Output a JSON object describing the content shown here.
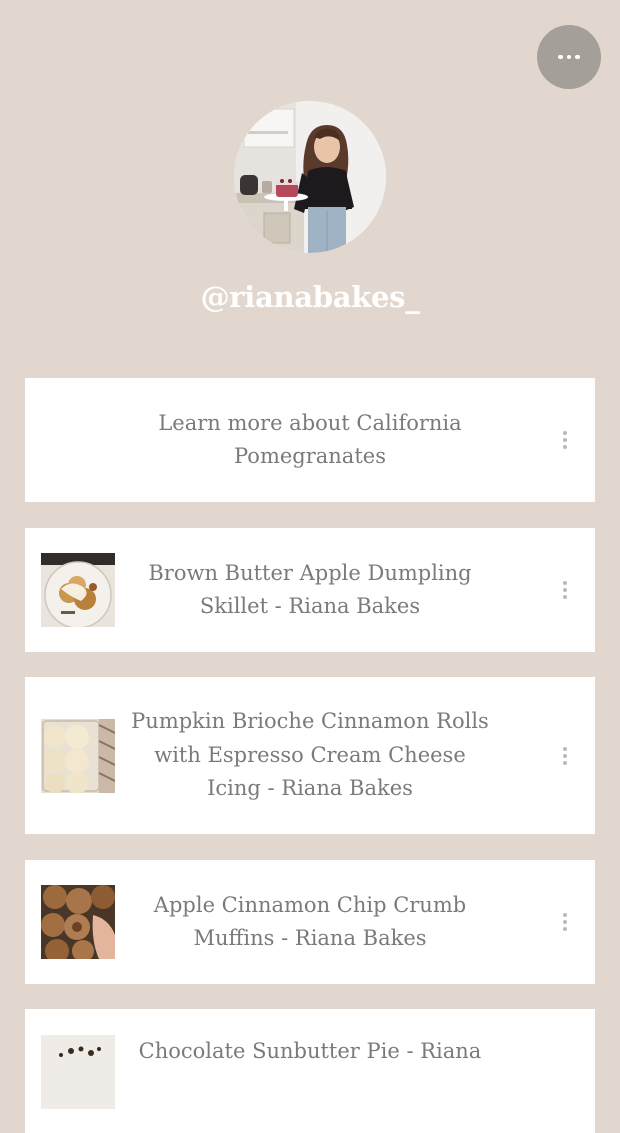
{
  "profile": {
    "handle": "@rianabakes_",
    "avatar_icon": "profile-photo"
  },
  "menu": {
    "icon": "more-horizontal-icon"
  },
  "links": [
    {
      "title": "Learn more about California Pomegranates",
      "has_thumbnail": false
    },
    {
      "title": "Brown Butter Apple Dumpling Skillet - Riana Bakes",
      "has_thumbnail": true
    },
    {
      "title": "Pumpkin Brioche Cinnamon Rolls with Espresso Cream Cheese Icing - Riana Bakes",
      "has_thumbnail": true
    },
    {
      "title": "Apple Cinnamon Chip Crumb Muffins - Riana Bakes",
      "has_thumbnail": true
    },
    {
      "title": "Chocolate Sunbutter Pie - Riana",
      "has_thumbnail": true
    }
  ],
  "colors": {
    "background": "#e2d7ce",
    "card": "#ffffff",
    "card_text": "#7a7a7a",
    "menu_button": "#a59f99",
    "handle_text": "#ffffff"
  }
}
